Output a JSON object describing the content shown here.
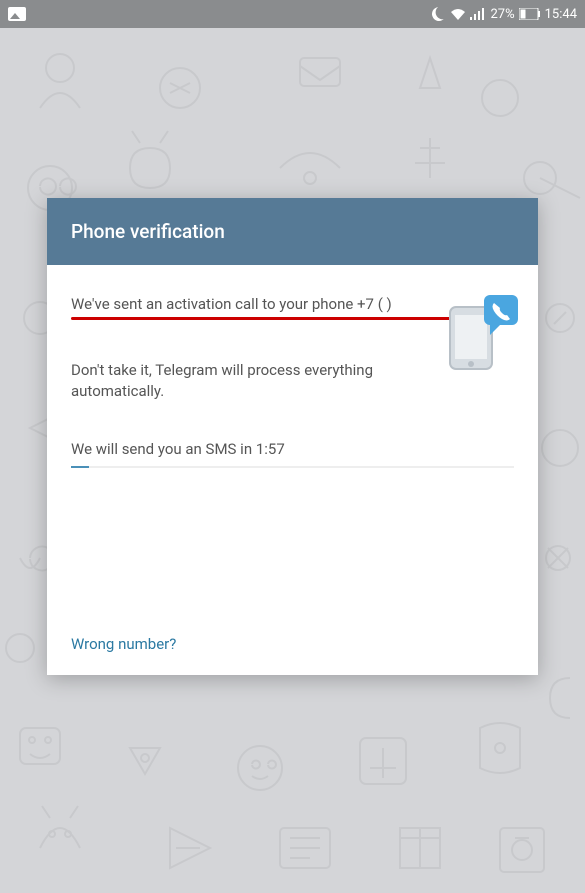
{
  "status_bar": {
    "battery_percent": "27%",
    "time": "15:44"
  },
  "dialog": {
    "title": "Phone verification",
    "sent_call_text": "We've sent an activation call to your phone +7 (        )",
    "dont_take_text": "Don't take it, Telegram will process everything automatically.",
    "sms_timer_text": "We will send you an SMS in 1:57",
    "wrong_number_text": "Wrong number?"
  }
}
